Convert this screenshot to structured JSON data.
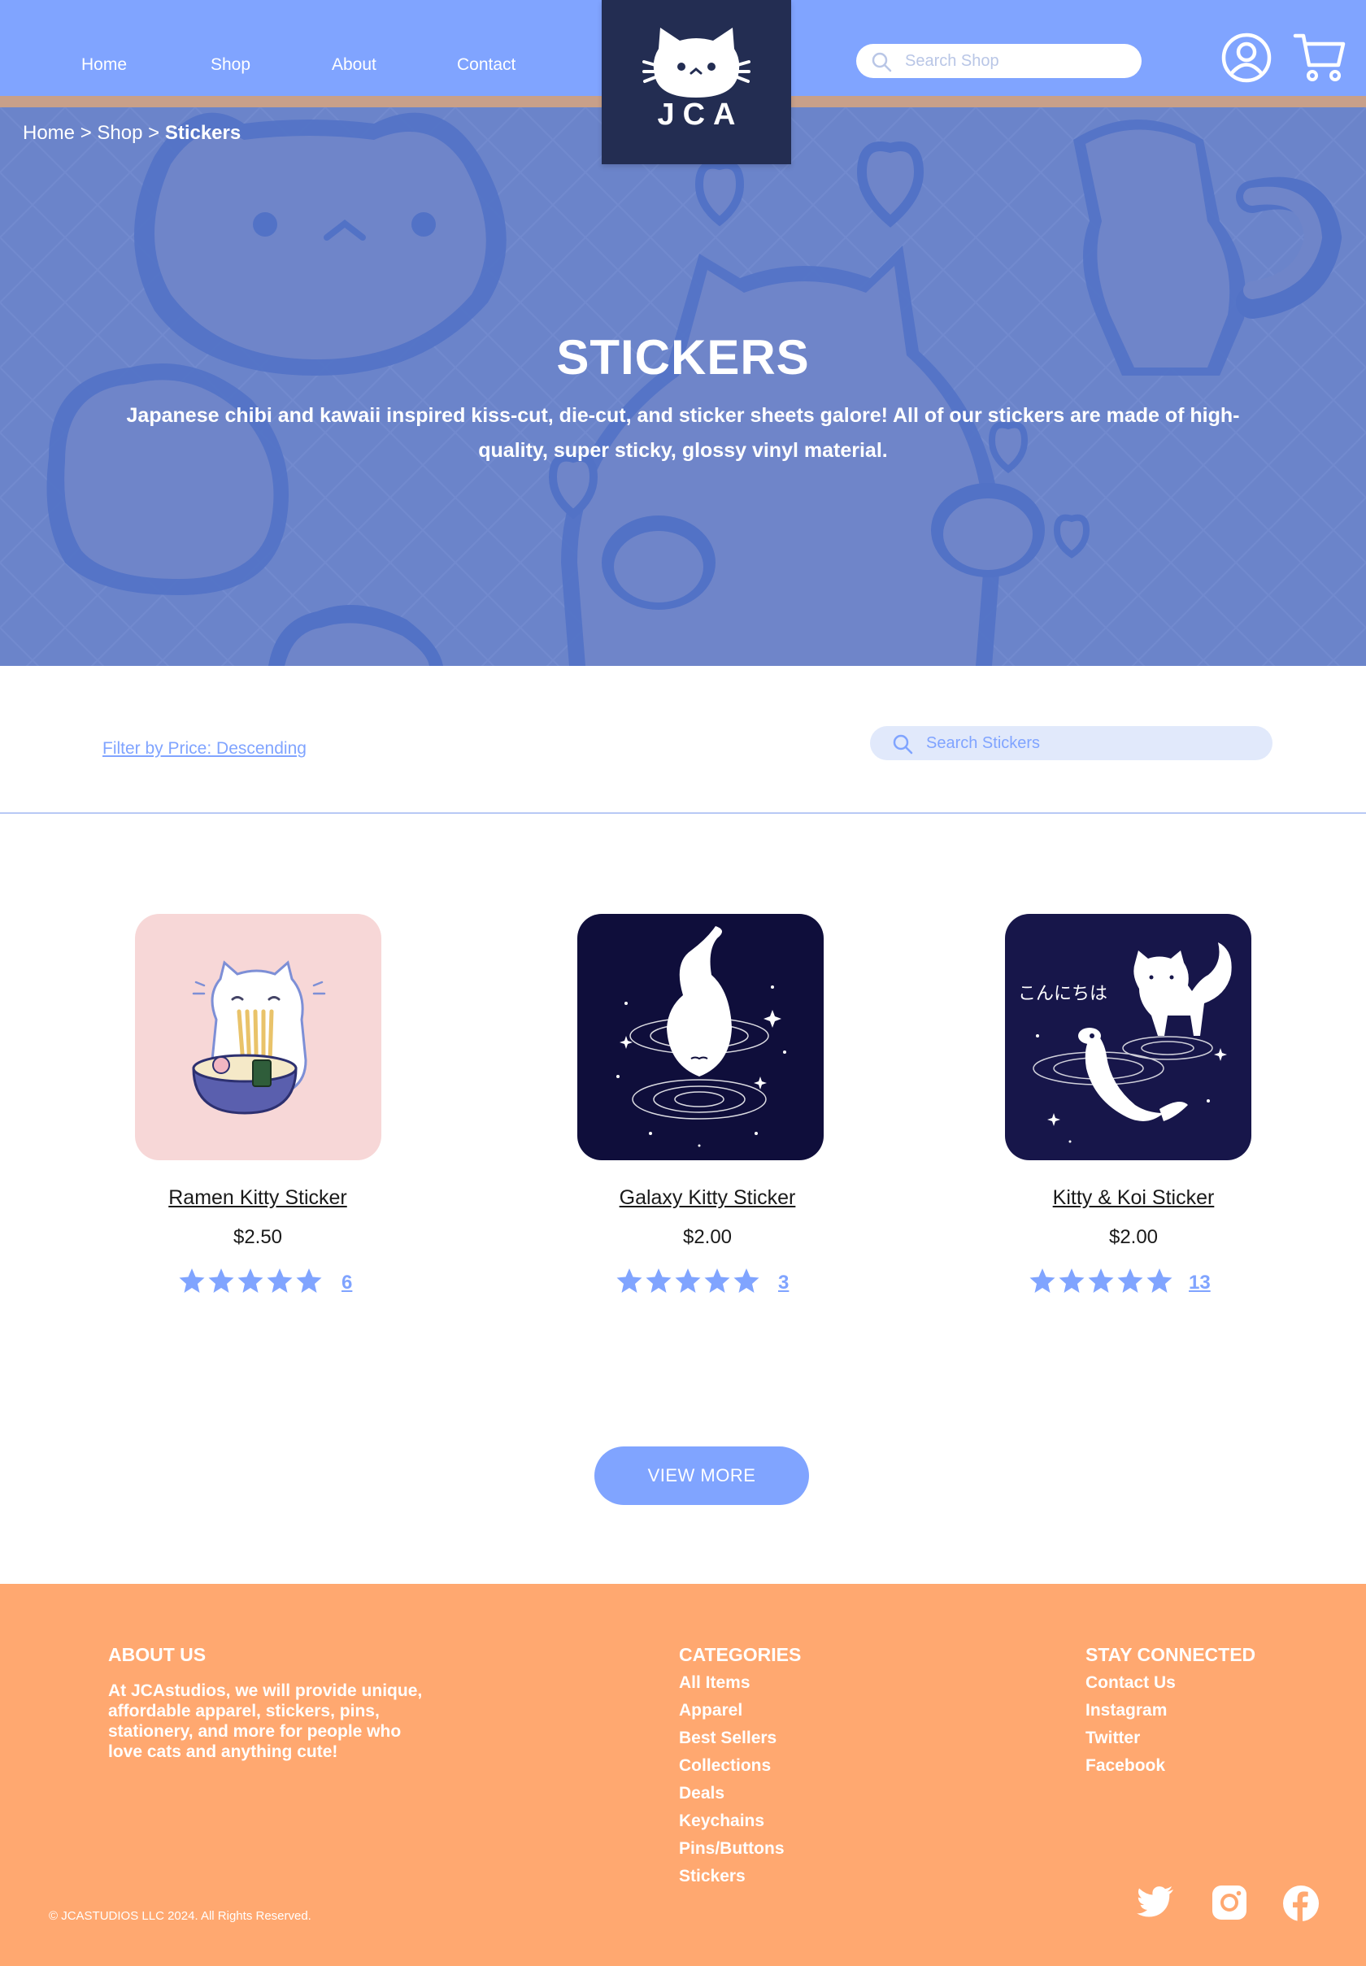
{
  "nav": {
    "items": [
      {
        "label": "Home"
      },
      {
        "label": "Shop"
      },
      {
        "label": "About"
      },
      {
        "label": "Contact"
      }
    ],
    "logo_text": "JCA",
    "search_placeholder": "Search Shop",
    "icons": [
      "search-icon",
      "user-icon",
      "cart-icon"
    ]
  },
  "breadcrumb": {
    "home": "Home",
    "shop": "Shop",
    "current": "Stickers",
    "separator": ">"
  },
  "hero": {
    "title": "STICKERS",
    "subtitle": "Japanese chibi and kawaii inspired kiss-cut, die-cut, and sticker sheets galore! All of our stickers are made of high-quality, super sticky, glossy vinyl material."
  },
  "filters": {
    "sort_label": "Filter by Price: Descending",
    "search_placeholder": "Search Stickers"
  },
  "products": [
    {
      "name": "Ramen Kitty Sticker",
      "price": "$2.50",
      "rating": 5,
      "review_count": "6",
      "image": "ramen-kitty-image",
      "bg": "#f7d7d7"
    },
    {
      "name": "Galaxy Kitty Sticker",
      "price": "$2.00",
      "rating": 5,
      "review_count": "3",
      "image": "galaxy-kitty-image",
      "bg": "#0f0e3b"
    },
    {
      "name": "Kitty & Koi Sticker",
      "price": "$2.00",
      "rating": 5,
      "review_count": "13",
      "image": "kitty-koi-image",
      "bg": "#17164a",
      "image_text": "こんにちは"
    }
  ],
  "view_more": "VIEW MORE",
  "footer": {
    "about_title": "ABOUT US",
    "about_text": "At JCAstudios, we will provide unique, affordable apparel, stickers, pins, stationery, and more for people who love cats and anything cute!",
    "categories_title": "CATEGORIES",
    "categories": [
      "All Items",
      "Apparel",
      "Best Sellers",
      "Collections",
      "Deals",
      "Keychains",
      "Pins/Buttons",
      "Stickers"
    ],
    "connect_title": "STAY CONNECTED",
    "connect": [
      "Contact Us",
      "Instagram",
      "Twitter",
      "Facebook"
    ],
    "copyright": "© JCASTUDIOS LLC 2024. All Rights Reserved.",
    "social_icons": [
      "twitter-icon",
      "instagram-icon",
      "facebook-icon"
    ]
  },
  "colors": {
    "primary": "#80a4ff",
    "navy": "#232d52",
    "footer": "#ffa870",
    "hero": "#8496cf",
    "light": "#e1e9fb"
  }
}
